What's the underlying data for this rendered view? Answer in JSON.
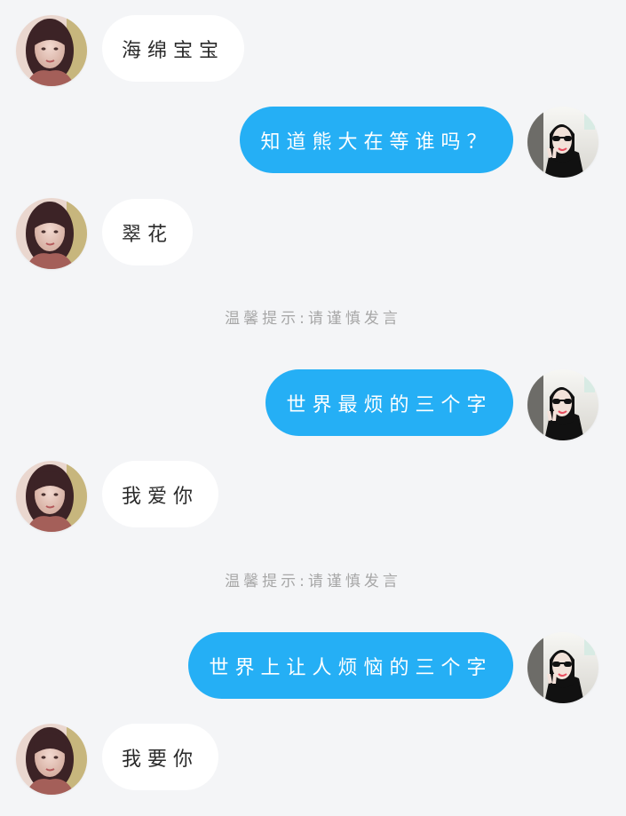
{
  "messages": [
    {
      "side": "left",
      "text": "海绵宝宝"
    },
    {
      "side": "right",
      "text": "知道熊大在等谁吗？"
    },
    {
      "side": "left",
      "text": "翠花"
    },
    {
      "side": "system",
      "text": "温馨提示:请谨慎发言"
    },
    {
      "side": "right",
      "text": "世界最烦的三个字"
    },
    {
      "side": "left",
      "text": "我爱你"
    },
    {
      "side": "system",
      "text": "温馨提示:请谨慎发言"
    },
    {
      "side": "right",
      "text": "世界上让人烦恼的三个字"
    },
    {
      "side": "left",
      "text": "我要你"
    }
  ],
  "colors": {
    "background": "#f4f5f7",
    "left_bubble": "#ffffff",
    "right_bubble": "#25aff5",
    "hint_text": "#a7a7a7"
  },
  "icons": {
    "left_avatar": "girl-avatar",
    "right_avatar": "sunglasses-avatar"
  }
}
